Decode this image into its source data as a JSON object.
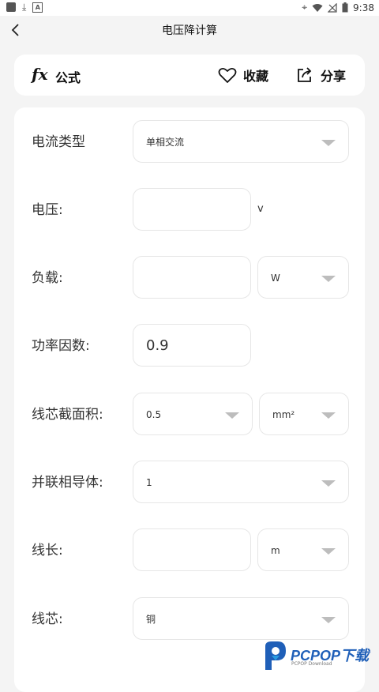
{
  "status_bar": {
    "time": "9:38"
  },
  "header": {
    "title": "电压降计算",
    "back_icon": "chevron-left-icon"
  },
  "toolbar": {
    "formula_icon_text": "fx",
    "formula_label": "公式",
    "favorite_label": "收藏",
    "share_label": "分享"
  },
  "form": {
    "current_type": {
      "label": "电流类型",
      "value": "单相交流"
    },
    "voltage": {
      "label": "电压:",
      "value": "",
      "unit": "v"
    },
    "load": {
      "label": "负载:",
      "value": "",
      "unit": "W"
    },
    "power_factor": {
      "label": "功率因数:",
      "value": "0.9"
    },
    "cross_section": {
      "label": "线芯截面积:",
      "value": "0.5",
      "unit": "mm²"
    },
    "parallel_conductors": {
      "label": "并联相导体:",
      "value": "1"
    },
    "length": {
      "label": "线长:",
      "value": "",
      "unit": "m"
    },
    "core": {
      "label": "线芯:",
      "value": "铜"
    }
  },
  "watermark": {
    "brand": "PCPOP下载",
    "sub": "PCPOP Download"
  },
  "colors": {
    "background": "#f4f4f4",
    "card": "#ffffff",
    "border": "#e6e6e6",
    "caret": "#bdbdbd",
    "watermark": "#1f5fb8"
  }
}
